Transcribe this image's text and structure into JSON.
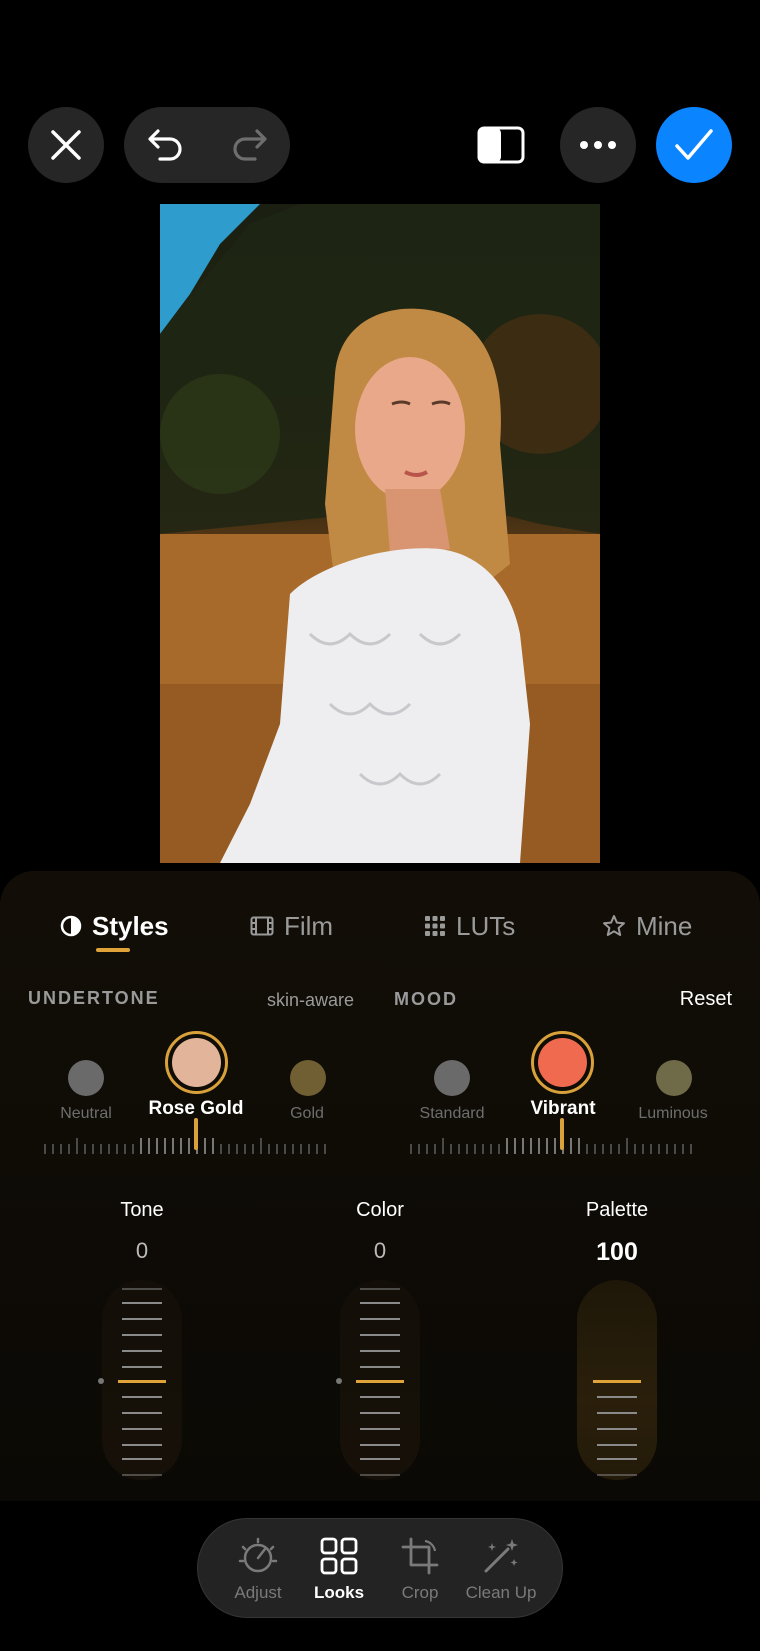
{
  "toolbar": {
    "close": "close-icon",
    "undo": "undo-icon",
    "redo": "redo-icon",
    "compare": "compare-icon",
    "more": "more-icon",
    "done": "checkmark-icon",
    "accent": "#0a84ff"
  },
  "tabs": [
    {
      "label": "Styles",
      "icon": "half-circle-icon",
      "active": true
    },
    {
      "label": "Film",
      "icon": "film-icon",
      "active": false
    },
    {
      "label": "LUTs",
      "icon": "grid-dots-icon",
      "active": false
    },
    {
      "label": "Mine",
      "icon": "star-icon",
      "active": false
    }
  ],
  "undertone": {
    "title": "UNDERTONE",
    "hint": "skin-aware",
    "options": [
      {
        "label": "Neutral",
        "color": "#6a6a6a"
      },
      {
        "label": "Rose Gold",
        "color": "#e2b49a",
        "selected": true
      },
      {
        "label": "Gold",
        "color": "#6f5f33"
      }
    ]
  },
  "mood": {
    "title": "MOOD",
    "reset": "Reset",
    "options": [
      {
        "label": "Standard",
        "color": "#6a6a6a"
      },
      {
        "label": "Vibrant",
        "color": "#ef6a4e",
        "selected": true
      },
      {
        "label": "Luminous",
        "color": "#6f6a48"
      }
    ]
  },
  "adjusters": [
    {
      "label": "Tone",
      "value": "0"
    },
    {
      "label": "Color",
      "value": "0"
    },
    {
      "label": "Palette",
      "value": "100"
    }
  ],
  "accent_gold": "#e0a33a",
  "nav": [
    {
      "label": "Adjust",
      "icon": "dial-icon"
    },
    {
      "label": "Looks",
      "icon": "looks-grid-icon",
      "active": true
    },
    {
      "label": "Crop",
      "icon": "crop-icon"
    },
    {
      "label": "Clean Up",
      "icon": "magic-wand-icon"
    }
  ]
}
